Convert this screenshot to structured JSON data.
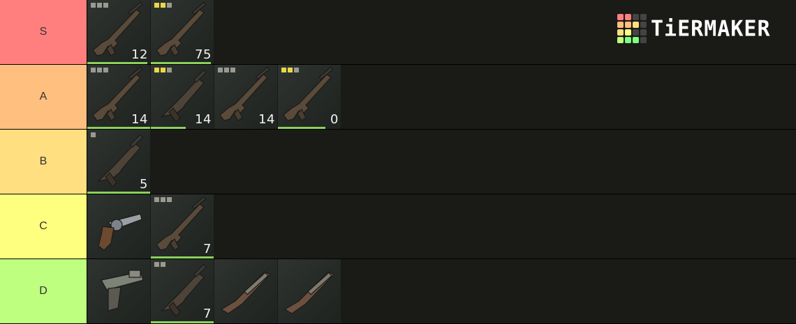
{
  "logo": {
    "text": "TiERMAKER",
    "grid_colors": [
      "#ff7f7f",
      "#ff7f7f",
      "#444444",
      "#444444",
      "#ffbf7f",
      "#ffbf7f",
      "#ffdf7f",
      "#444444",
      "#ffdf7f",
      "#ffff7f",
      "#444444",
      "#444444",
      "#bfff7f",
      "#7fff7f",
      "#7fff7f",
      "#444444"
    ]
  },
  "tiers": [
    {
      "label": "S",
      "color": "#ff7f7f",
      "items": [
        {
          "name": "assault-rifle-1",
          "dots": [
            "grey",
            "grey",
            "grey"
          ],
          "count": "12",
          "bar": 0.95,
          "icon": "rifle-icon"
        },
        {
          "name": "assault-rifle-2",
          "dots": [
            "yellow",
            "yellow",
            "grey"
          ],
          "count": "75",
          "bar": 0.95,
          "icon": "rifle-icon"
        }
      ]
    },
    {
      "label": "A",
      "color": "#ffbf7f",
      "items": [
        {
          "name": "assault-rifle-3",
          "dots": [
            "grey",
            "grey",
            "grey"
          ],
          "count": "14",
          "bar": 1.0,
          "icon": "rifle-icon"
        },
        {
          "name": "smg-1",
          "dots": [
            "yellow",
            "yellow",
            "grey"
          ],
          "count": "14",
          "bar": 0.55,
          "icon": "smg-icon"
        },
        {
          "name": "m4-rifle",
          "dots": [
            "grey",
            "grey",
            "grey"
          ],
          "count": "14",
          "bar": 0.0,
          "icon": "rifle-icon"
        },
        {
          "name": "carbine-1",
          "dots": [
            "yellow",
            "yellow",
            "grey"
          ],
          "count": "0",
          "bar": 0.75,
          "icon": "rifle-icon"
        }
      ]
    },
    {
      "label": "B",
      "color": "#ffdf7f",
      "items": [
        {
          "name": "drum-smg",
          "dots": [
            "grey"
          ],
          "count": "5",
          "bar": 1.0,
          "icon": "smg-icon"
        }
      ]
    },
    {
      "label": "C",
      "color": "#ffff7f",
      "items": [
        {
          "name": "revolver",
          "dots": [],
          "count": "",
          "bar": 0.0,
          "icon": "revolver-icon"
        },
        {
          "name": "rifle-c",
          "dots": [
            "grey",
            "grey",
            "grey"
          ],
          "count": "7",
          "bar": 1.0,
          "icon": "rifle-icon"
        }
      ]
    },
    {
      "label": "D",
      "color": "#bfff7f",
      "items": [
        {
          "name": "pistol",
          "dots": [],
          "count": "",
          "bar": 0.0,
          "icon": "pistol-icon"
        },
        {
          "name": "smg-d",
          "dots": [
            "grey",
            "grey"
          ],
          "count": "7",
          "bar": 1.0,
          "icon": "smg-icon"
        },
        {
          "name": "shotgun-1",
          "dots": [],
          "count": "",
          "bar": 0.0,
          "icon": "shotgun-icon"
        },
        {
          "name": "shotgun-2",
          "dots": [],
          "count": "",
          "bar": 0.0,
          "icon": "shotgun-icon"
        }
      ]
    }
  ]
}
